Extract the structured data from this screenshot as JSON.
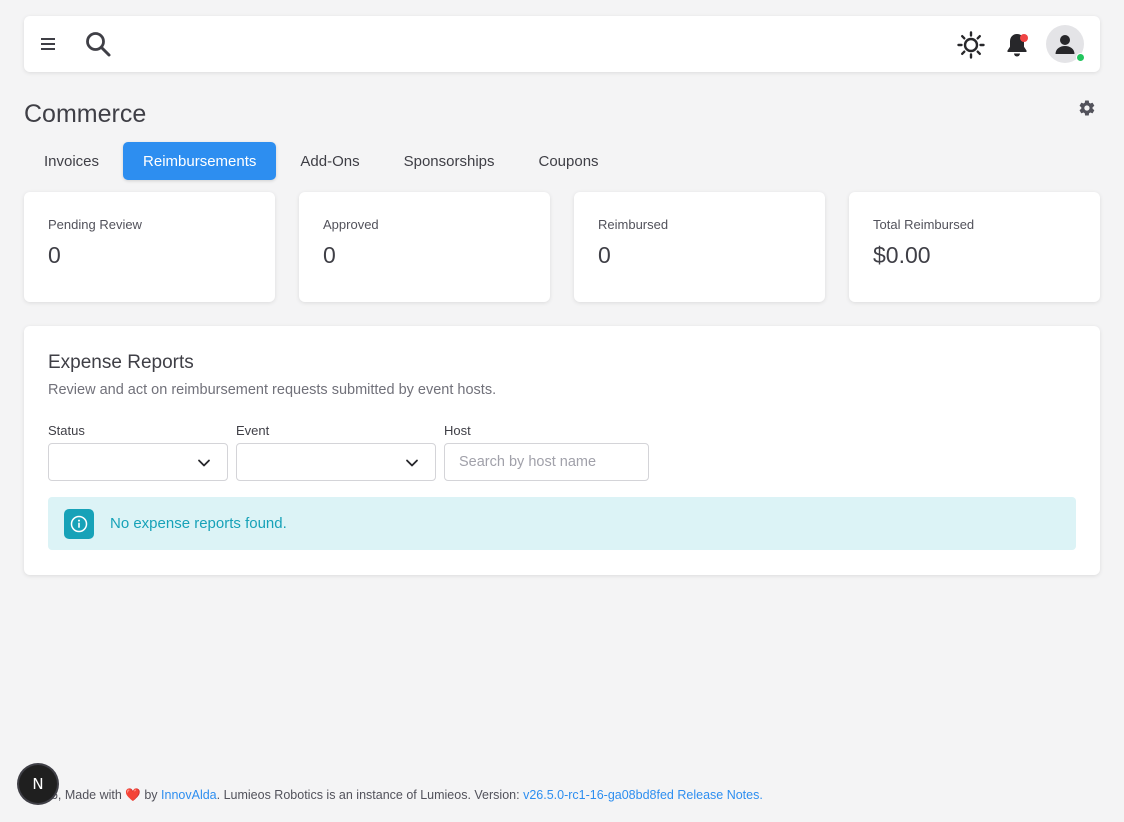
{
  "header": {
    "menu_icon": "hamburger-icon",
    "search_icon": "search-icon",
    "theme_icon": "sun-icon",
    "notifications_icon": "bell-icon",
    "avatar_icon": "user-icon"
  },
  "page": {
    "title": "Commerce",
    "settings_icon": "gear-icon"
  },
  "tabs": [
    {
      "label": "Invoices",
      "active": false
    },
    {
      "label": "Reimbursements",
      "active": true
    },
    {
      "label": "Add-Ons",
      "active": false
    },
    {
      "label": "Sponsorships",
      "active": false
    },
    {
      "label": "Coupons",
      "active": false
    }
  ],
  "stats": [
    {
      "label": "Pending Review",
      "value": "0"
    },
    {
      "label": "Approved",
      "value": "0"
    },
    {
      "label": "Reimbursed",
      "value": "0"
    },
    {
      "label": "Total Reimbursed",
      "value": "$0.00"
    }
  ],
  "expense_reports": {
    "title": "Expense Reports",
    "subtitle": "Review and act on reimbursement requests submitted by event hosts.",
    "filters": {
      "status_label": "Status",
      "status_value": "",
      "event_label": "Event",
      "event_value": "",
      "host_label": "Host",
      "host_placeholder": "Search by host name"
    },
    "empty_message": "No expense reports found.",
    "info_icon": "info-icon"
  },
  "footer": {
    "prefix": "26, Made with ",
    "heart": "❤️",
    "by": " by ",
    "company_link": "InnovAlda",
    "middle": ". Lumieos Robotics is an instance of Lumieos. Version: ",
    "version_link": "v26.5.0-rc1-16-ga08bd8fed",
    "release_notes_link": "Release Notes."
  },
  "badge": {
    "letter": "N"
  },
  "colors": {
    "accent": "#2d8ef0",
    "info_bg": "#dcf3f6",
    "info_text": "#17a2b8",
    "notification_dot": "#ef4444",
    "online_dot": "#22c55e"
  }
}
